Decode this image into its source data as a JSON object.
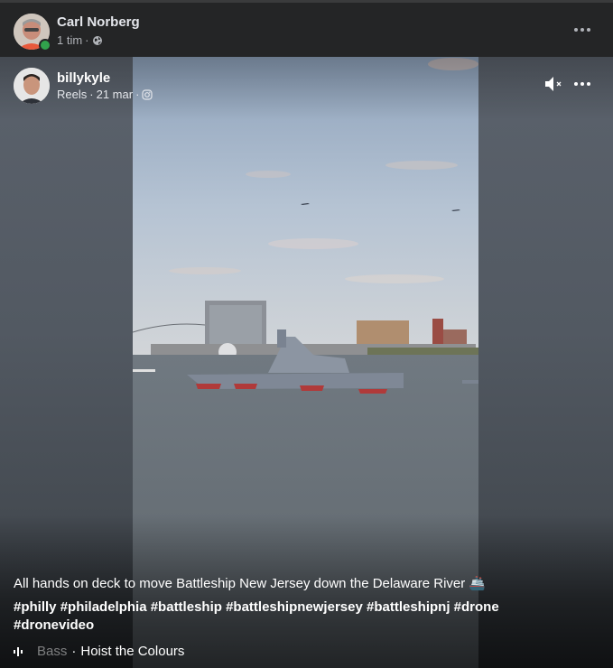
{
  "post": {
    "author": "Carl Norberg",
    "time": "1 tim",
    "separator": "·",
    "audience_icon": "globe-icon",
    "more_icon": "more-horizontal-icon"
  },
  "reel": {
    "author": "billykyle",
    "source": "Reels",
    "date": "21 mar",
    "separator": "·",
    "platform_icon": "instagram-icon",
    "mute_icon": "speaker-muted-icon",
    "more_icon": "more-horizontal-icon",
    "caption": "All hands on deck to move Battleship New Jersey down the Delaware River 🚢",
    "hashtags": [
      "#philly",
      "#philadelphia",
      "#battleship",
      "#battleshipnewjersey",
      "#battleshipnj",
      "#drone",
      "#dronevideo"
    ],
    "audio": {
      "icon": "audio-wave-icon",
      "artist": "Bass",
      "separator": "·",
      "title": "Hoist the Colours"
    }
  },
  "colors": {
    "background": "#242526",
    "text_primary": "#e4e6eb",
    "text_secondary": "#b0b3b8",
    "online": "#31a24c"
  }
}
